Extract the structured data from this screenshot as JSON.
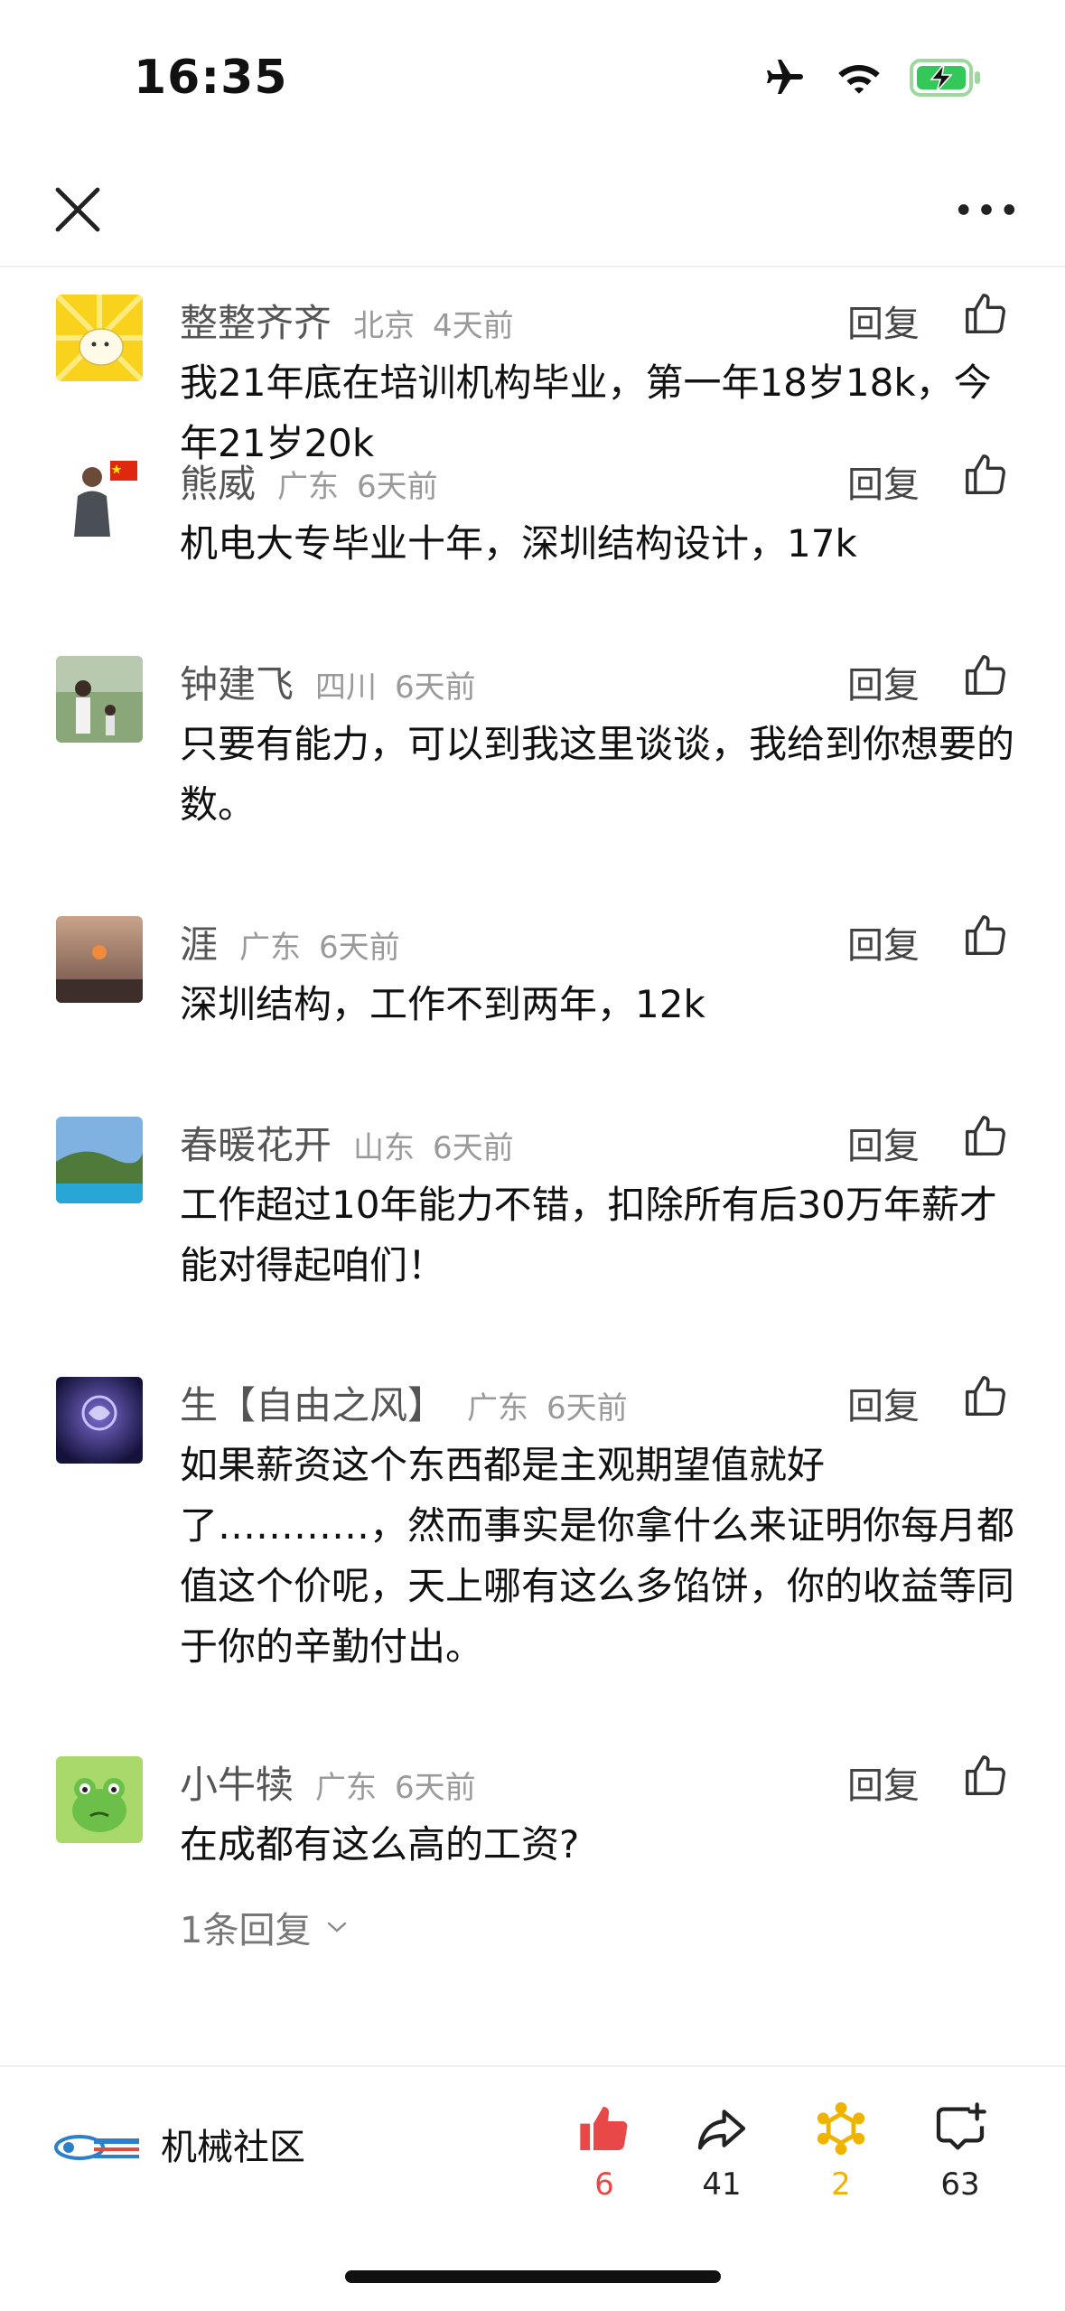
{
  "status_bar": {
    "time": "16:35"
  },
  "comments": [
    {
      "name": "整整齐齐",
      "location": "北京",
      "time": "4天前",
      "reply_label": "回复",
      "text": "我21年底在培训机构毕业，第一年18岁18k，今年21岁20k"
    },
    {
      "name": "熊威",
      "location": "广东",
      "time": "6天前",
      "reply_label": "回复",
      "text": "机电大专毕业十年，深圳结构设计，17k"
    },
    {
      "name": "钟建飞",
      "location": "四川",
      "time": "6天前",
      "reply_label": "回复",
      "text": "只要有能力，可以到我这里谈谈，我给到你想要的数。"
    },
    {
      "name": "涯",
      "location": "广东",
      "time": "6天前",
      "reply_label": "回复",
      "text": "深圳结构，工作不到两年，12k"
    },
    {
      "name": "春暖花开",
      "location": "山东",
      "time": "6天前",
      "reply_label": "回复",
      "text": "工作超过10年能力不错，扣除所有后30万年薪才能对得起咱们！"
    },
    {
      "name": "生【自由之风】",
      "location": "广东",
      "time": "6天前",
      "reply_label": "回复",
      "text": "如果薪资这个东西都是主观期望值就好了…………，然而事实是你拿什么来证明你每月都值这个价呢，天上哪有这么多馅饼，你的收益等同于你的辛勤付出。"
    },
    {
      "name": "小牛犊",
      "location": "广东",
      "time": "6天前",
      "reply_label": "回复",
      "text": "在成都有这么高的工资?",
      "sub_replies": "1条回复"
    }
  ],
  "bottom_bar": {
    "brand_name": "机械社区",
    "like_count": "6",
    "share_count": "41",
    "favorite_count": "2",
    "comment_count": "63"
  },
  "colors": {
    "like_red": "#e94848",
    "favorite_gold": "#f0b400"
  }
}
